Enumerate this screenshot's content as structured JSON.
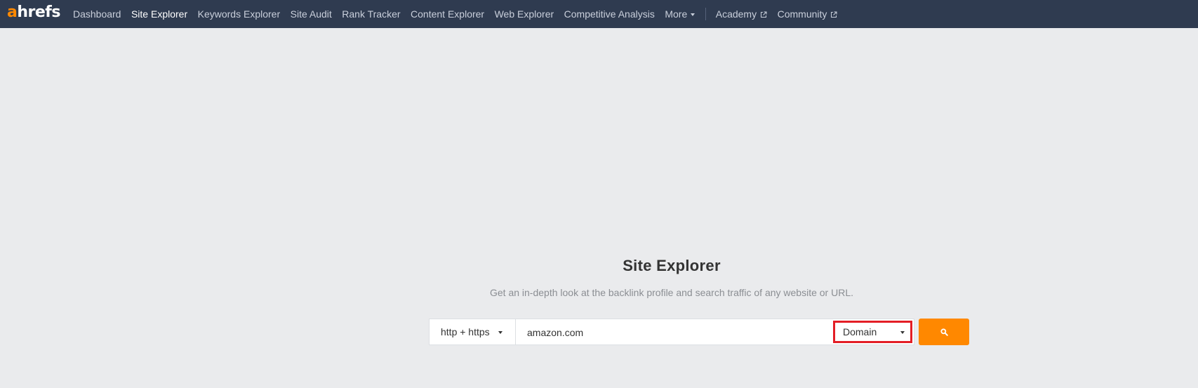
{
  "nav": {
    "logo": {
      "accent": "a",
      "rest": "hrefs"
    },
    "items": [
      {
        "label": "Dashboard",
        "active": false
      },
      {
        "label": "Site Explorer",
        "active": true
      },
      {
        "label": "Keywords Explorer",
        "active": false
      },
      {
        "label": "Site Audit",
        "active": false
      },
      {
        "label": "Rank Tracker",
        "active": false
      },
      {
        "label": "Content Explorer",
        "active": false
      },
      {
        "label": "Web Explorer",
        "active": false
      },
      {
        "label": "Competitive Analysis",
        "active": false
      },
      {
        "label": "More",
        "active": false
      }
    ],
    "external": [
      {
        "label": "Academy",
        "icon": "external-link-icon"
      },
      {
        "label": "Community",
        "icon": "external-link-icon"
      }
    ]
  },
  "main": {
    "title": "Site Explorer",
    "subtitle": "Get an in-depth look at the backlink profile and search traffic of any website or URL."
  },
  "search": {
    "protocol": "http + https",
    "query": "amazon.com",
    "mode": "Domain",
    "button_icon": "search-icon"
  },
  "colors": {
    "nav_bg": "#2f3b50",
    "page_bg": "#eaebed",
    "accent": "#ff8800",
    "highlight_border": "#e31e26"
  }
}
